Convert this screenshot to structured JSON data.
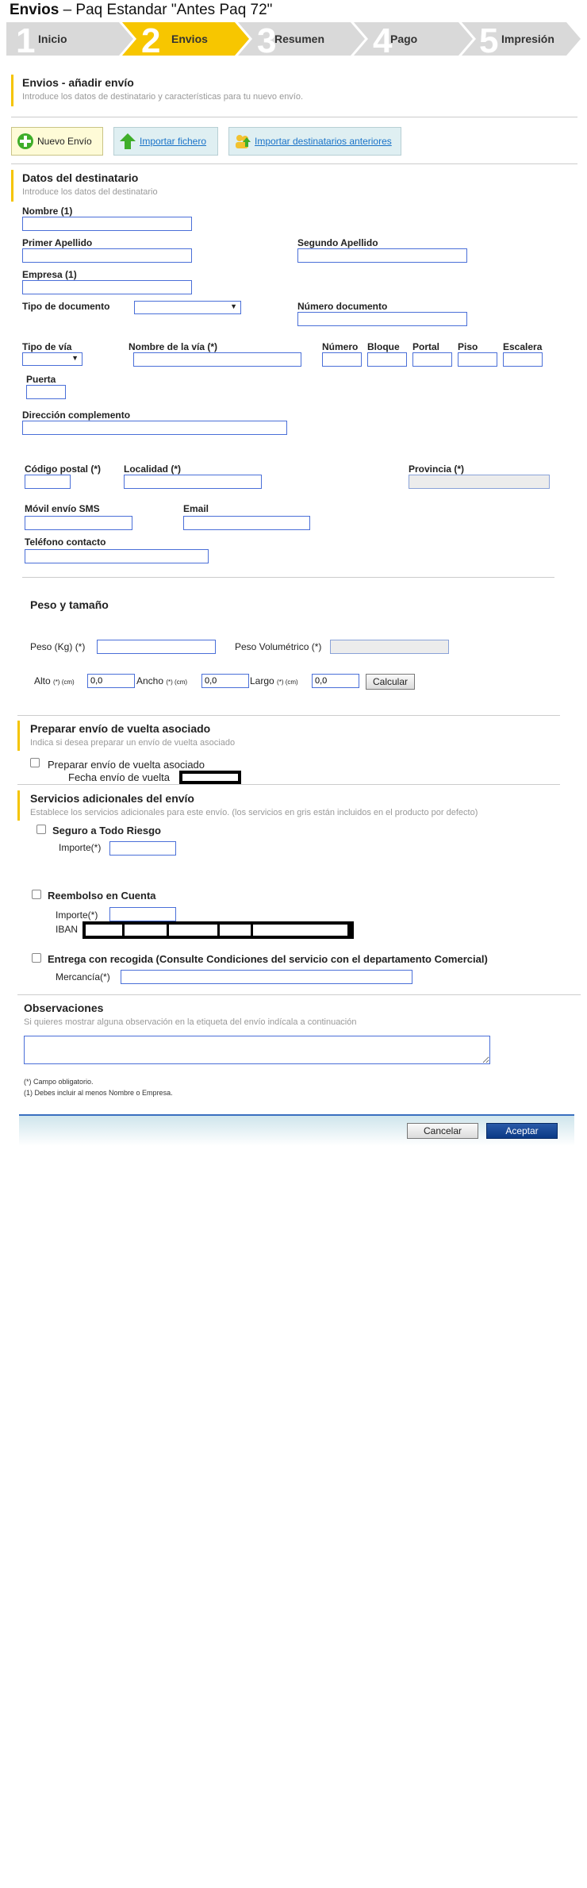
{
  "page": {
    "title_bold": "Envios",
    "title_rest": " – Paq Estandar \"Antes Paq 72\""
  },
  "steps": [
    {
      "num": "1",
      "label": "Inicio",
      "active": false
    },
    {
      "num": "2",
      "label": "Envios",
      "active": true
    },
    {
      "num": "3",
      "label": "Resumen",
      "active": false
    },
    {
      "num": "4",
      "label": "Pago",
      "active": false
    },
    {
      "num": "5",
      "label": "Impresión",
      "active": false
    }
  ],
  "header": {
    "title": "Envios - añadir envío",
    "subtitle": "Introduce los datos de destinatario y características para tu nuevo envío."
  },
  "actions": {
    "new": "Nuevo Envío",
    "import_file": "Importar fichero",
    "import_prev": "Importar destinatarios anteriores"
  },
  "recipient": {
    "title": "Datos del destinatario",
    "subtitle": "Introduce los datos del destinatario",
    "nombre": "Nombre (1)",
    "apellido1": "Primer Apellido",
    "apellido2": "Segundo Apellido",
    "empresa": "Empresa (1)",
    "tipo_doc": "Tipo de documento",
    "num_doc": "Número documento",
    "tipo_via": "Tipo de vía",
    "nombre_via": "Nombre de la vía (*)",
    "numero": "Número",
    "bloque": "Bloque",
    "portal": "Portal",
    "piso": "Piso",
    "escalera": "Escalera",
    "puerta": "Puerta",
    "dir_comp": "Dirección complemento",
    "cp": "Código postal (*)",
    "localidad": "Localidad (*)",
    "provincia": "Provincia (*)",
    "movil": "Móvil envío SMS",
    "email": "Email",
    "telefono": "Teléfono contacto"
  },
  "weight": {
    "title": "Peso y tamaño",
    "peso": "Peso (Kg) (*)",
    "peso_vol": "Peso Volumétrico (*)",
    "alto": "Alto",
    "ancho": "Ancho",
    "largo": "Largo",
    "unit": "(*) (cm)",
    "alto_val": "0,0",
    "ancho_val": "0,0",
    "largo_val": "0,0",
    "calcular": "Calcular"
  },
  "return": {
    "title": "Preparar envío de vuelta asociado",
    "subtitle": "Indica si desea preparar un envío de vuelta asociado",
    "check": "Preparar envío de vuelta asociado",
    "fecha": "Fecha envío de vuelta"
  },
  "services": {
    "title": "Servicios adicionales del envío",
    "subtitle": "Establece los servicios adicionales para este envío. (los servicios en gris están incluidos en el producto por defecto)",
    "seguro": "Seguro a Todo Riesgo",
    "importe": "Importe(*)",
    "reembolso": "Reembolso en Cuenta",
    "iban": "IBAN",
    "entrega": "Entrega con recogida (Consulte Condiciones del servicio con el departamento Comercial)",
    "mercancia": "Mercancía(*)"
  },
  "observ": {
    "title": "Observaciones",
    "subtitle": "Si quieres mostrar alguna observación en la etiqueta del envío indícala a continuación"
  },
  "notes": {
    "n1": "(*) Campo obligatorio.",
    "n2": "(1) Debes incluir al menos Nombre o Empresa."
  },
  "footer": {
    "cancel": "Cancelar",
    "accept": "Aceptar"
  },
  "colors": {
    "active_step": "#f7c600",
    "inactive_step": "#d9d9d9",
    "accent_bar": "#f5c400",
    "input_border": "#4a6fd8",
    "primary_button": "#0b3a86"
  }
}
